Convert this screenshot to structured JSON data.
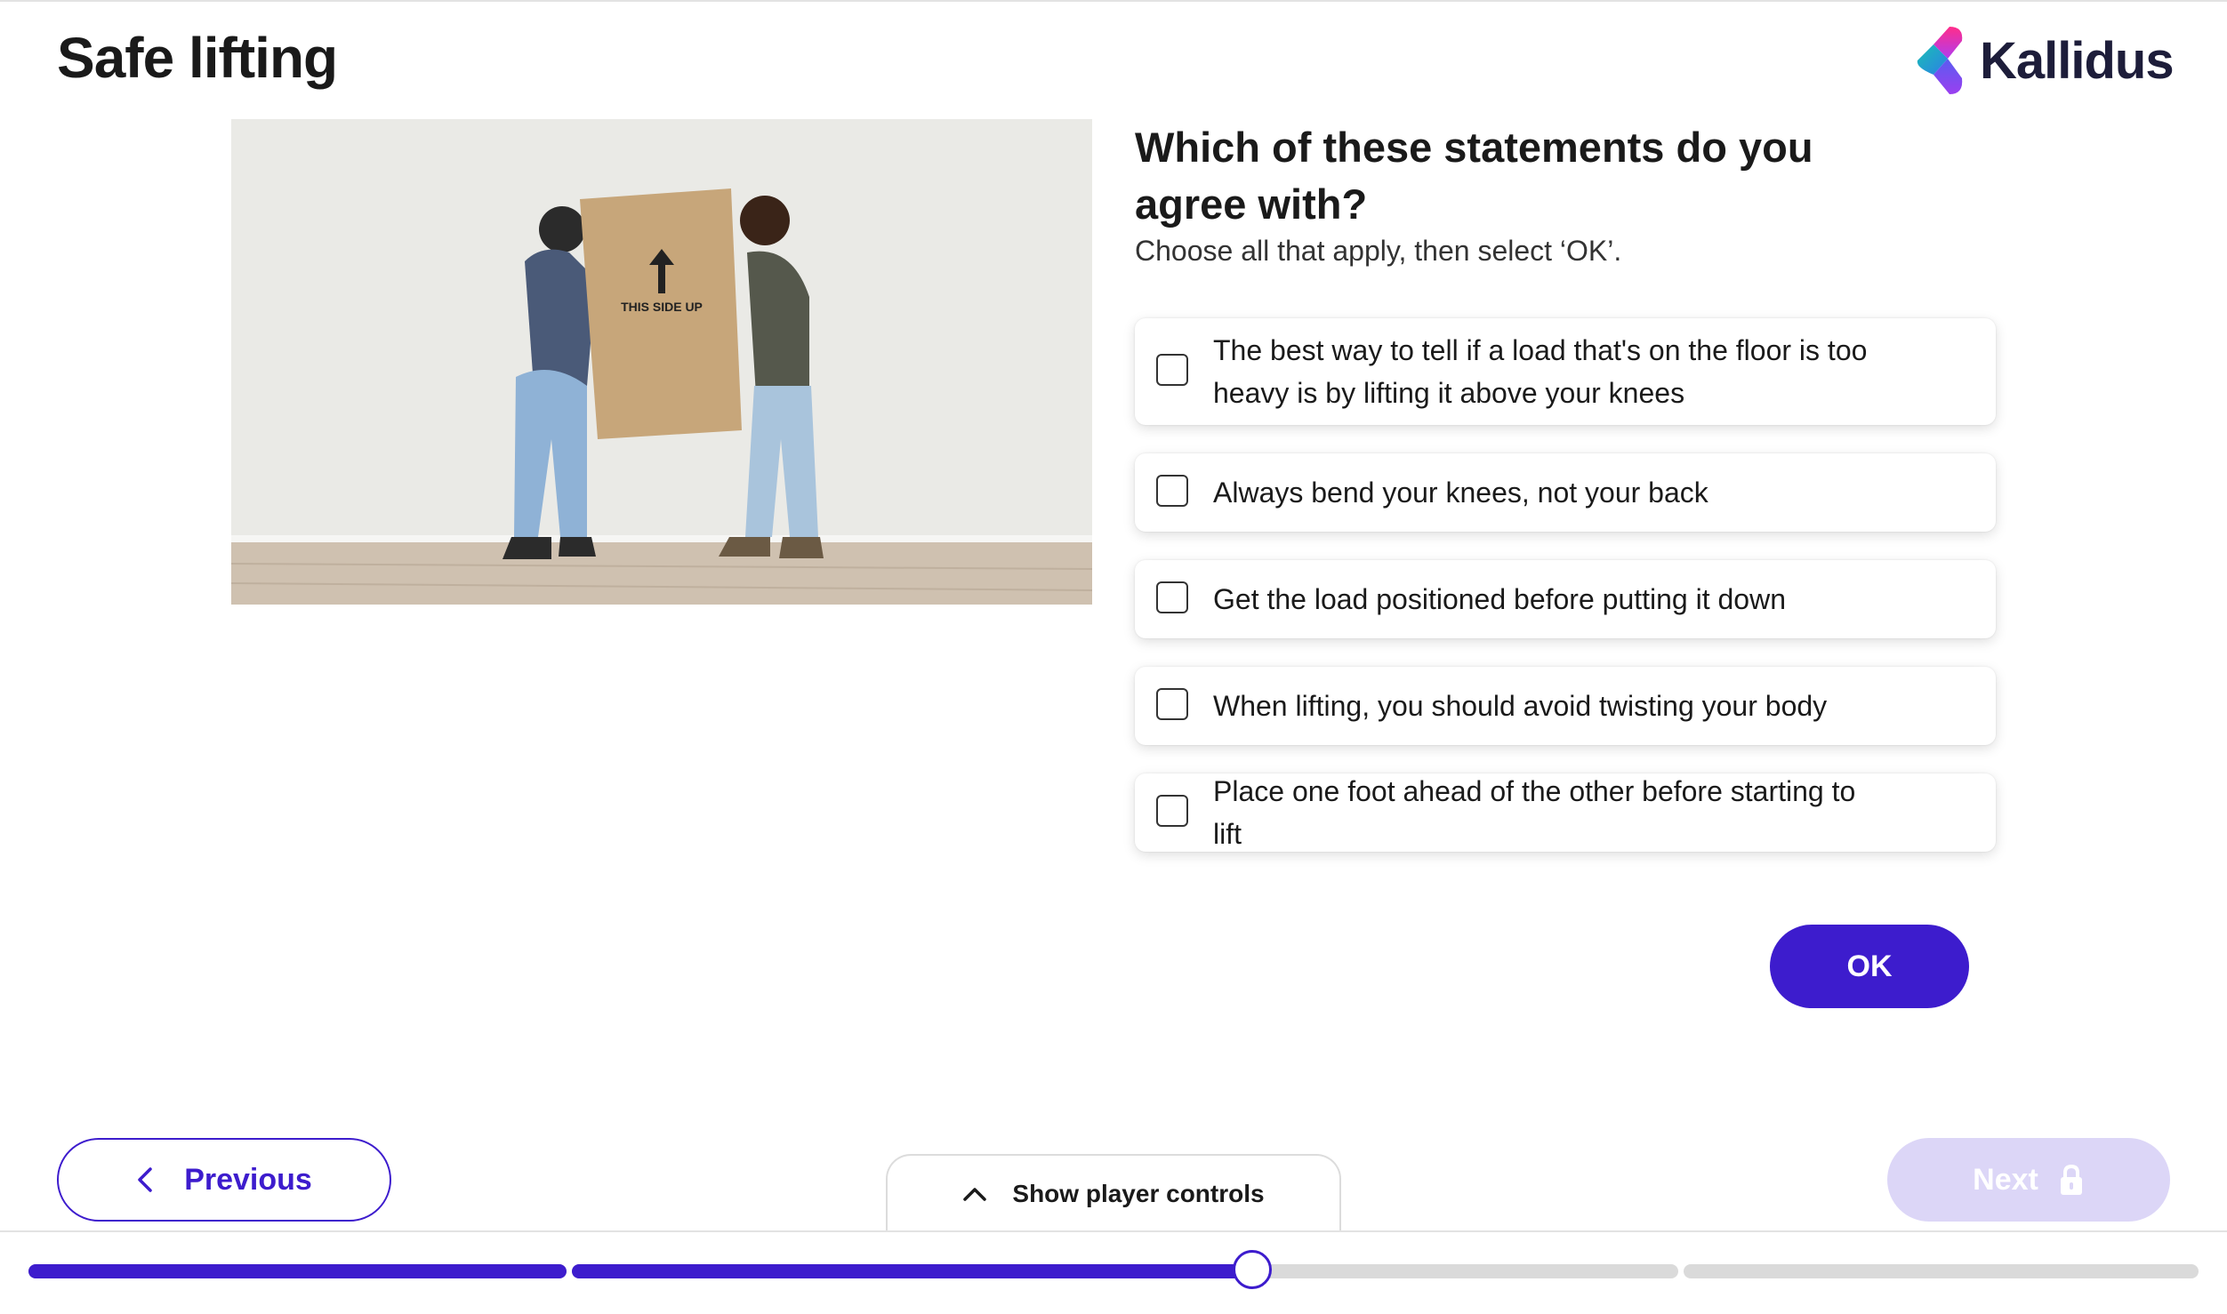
{
  "header": {
    "title": "Safe lifting",
    "brand": "Kallidus"
  },
  "image": {
    "box_text": "THIS SIDE UP"
  },
  "question": {
    "text": "Which of these statements do you agree with?",
    "instruction": "Choose all that apply, then select ‘OK’.",
    "options": [
      {
        "label": "The best way to tell if a load that's on the floor is too heavy is by lifting it above your knees",
        "checked": false
      },
      {
        "label": "Always bend your knees, not your back",
        "checked": false
      },
      {
        "label": "Get the load positioned before putting it down",
        "checked": false
      },
      {
        "label": "When lifting, you should avoid twisting your body",
        "checked": false
      },
      {
        "label": "Place one foot ahead of the other before starting to lift",
        "checked": false
      }
    ],
    "ok_label": "OK"
  },
  "nav": {
    "previous_label": "Previous",
    "next_label": "Next",
    "next_locked": true,
    "player_controls_label": "Show player controls"
  },
  "progress": {
    "segments": [
      {
        "fill": 1.0
      },
      {
        "fill": 0.615
      },
      {
        "fill": 0.0
      }
    ]
  },
  "colors": {
    "accent": "#3d1ccd",
    "next_disabled": "#dcd6f7",
    "track": "#dadada"
  },
  "icons": {
    "logo": "kallidus-logo-icon",
    "previous": "chevron-left-icon",
    "controls": "chevron-up-icon",
    "next": "lock-icon"
  }
}
